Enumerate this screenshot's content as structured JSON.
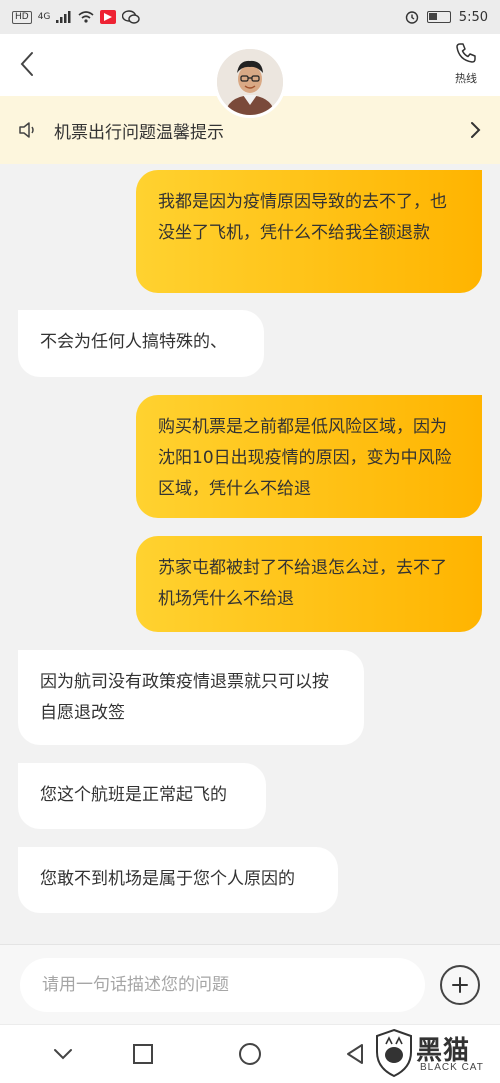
{
  "status_bar": {
    "network": "HD",
    "signal_label": "4G",
    "time": "5:50",
    "icons": [
      "signal-icon",
      "wifi-icon",
      "app-icon",
      "wechat-icon",
      "alarm-icon",
      "battery-icon"
    ]
  },
  "header": {
    "back_icon": "chevron-left-icon",
    "hotline_label": "热线",
    "hotline_icon": "phone-icon"
  },
  "notice": {
    "icon": "speaker-icon",
    "text": "机票出行问题温馨提示",
    "chevron": "chevron-right-icon"
  },
  "messages": [
    {
      "side": "out",
      "text": "我都是因为疫情原因导致的去不了，也没坐了飞机，凭什么不给我全额退款"
    },
    {
      "side": "in",
      "text": "不会为任何人搞特殊的、"
    },
    {
      "side": "out",
      "text": "购买机票是之前都是低风险区域，因为沈阳10日出现疫情的原因，变为中风险区域，凭什么不给退"
    },
    {
      "side": "out",
      "text": "苏家屯都被封了不给退怎么过，去不了机场凭什么不给退"
    },
    {
      "side": "in",
      "text": "因为航司没有政策疫情退票就只可以按自愿退改签"
    },
    {
      "side": "in",
      "text": "您这个航班是正常起飞的"
    },
    {
      "side": "in",
      "text": "您敢不到机场是属于您个人原因的"
    }
  ],
  "input": {
    "placeholder": "请用一句话描述您的问题"
  },
  "watermark": {
    "title": "黑猫",
    "subtitle": "BLACK CAT"
  },
  "colors": {
    "outgoing_start": "#ffd230",
    "outgoing_end": "#ffb400",
    "incoming": "#ffffff",
    "notice_bg": "#fdf6dd",
    "page_bg": "#f2f2f2"
  }
}
